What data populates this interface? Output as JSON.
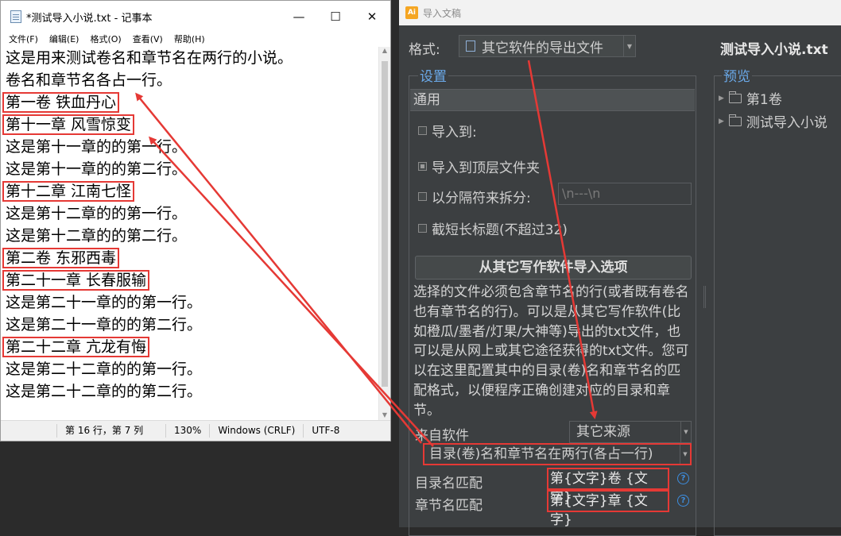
{
  "notepad": {
    "title": "*测试导入小说.txt - 记事本",
    "window_buttons": {
      "minimize": "—",
      "maximize": "☐",
      "close": "✕"
    },
    "menu": [
      "文件(F)",
      "编辑(E)",
      "格式(O)",
      "查看(V)",
      "帮助(H)"
    ],
    "lines": [
      {
        "text": "这是用来测试卷名和章节名在两行的小说。",
        "highlight": false
      },
      {
        "text": "卷名和章节名各占一行。",
        "highlight": false
      },
      {
        "text": "第一卷 铁血丹心",
        "highlight": true
      },
      {
        "text": "第十一章 风雪惊变",
        "highlight": true
      },
      {
        "text": "这是第十一章的的第一行。",
        "highlight": false
      },
      {
        "text": "这是第十一章的的第二行。",
        "highlight": false
      },
      {
        "text": "第十二章 江南七怪",
        "highlight": true
      },
      {
        "text": "这是第十二章的的第一行。",
        "highlight": false
      },
      {
        "text": "这是第十二章的的第二行。",
        "highlight": false
      },
      {
        "text": "第二卷 东邪西毒",
        "highlight": true
      },
      {
        "text": "第二十一章 长春服输",
        "highlight": true
      },
      {
        "text": "这是第二十一章的的第一行。",
        "highlight": false
      },
      {
        "text": "这是第二十一章的的第二行。",
        "highlight": false
      },
      {
        "text": "第二十二章 亢龙有悔",
        "highlight": true
      },
      {
        "text": "这是第二十二章的的第一行。",
        "highlight": false
      },
      {
        "text": "这是第二十二章的的第二行。",
        "highlight": false
      },
      {
        "text": "",
        "highlight": false
      },
      {
        "text": ".......",
        "highlight": false
      }
    ],
    "status": {
      "position": "第 16 行，第 7 列",
      "zoom": "130%",
      "line_ending": "Windows (CRLF)",
      "encoding": "UTF-8"
    }
  },
  "import_dialog": {
    "app_icon": "Ai",
    "title": "导入文稿",
    "format_label": "格式:",
    "format_value": "其它软件的导出文件",
    "settings_label": "设置",
    "general_label": "通用",
    "options": [
      {
        "label": "导入到:",
        "checked": false
      },
      {
        "label": "导入到顶层文件夹",
        "checked": true
      },
      {
        "label": "以分隔符来拆分:",
        "checked": false
      },
      {
        "label": "截短长标题(不超过32)",
        "checked": false
      }
    ],
    "separator_value": "\\n---\\n",
    "section_title": "从其它写作软件导入选项",
    "description": "选择的文件必须包含章节名的行(或者既有卷名也有章节名的行)。可以是从其它写作软件(比如橙瓜/墨者/灯果/大神等)导出的txt文件，也可以是从网上或其它途径获得的txt文件。您可以在这里配置其中的目录(卷)名和章节名的匹配格式，以便程序正确创建对应的目录和章节。",
    "source_label": "来自软件",
    "source_value": "其它来源",
    "mode_value": "目录(卷)名和章节名在两行(各占一行)",
    "catalog_label": "目录名匹配",
    "catalog_pattern": "第{文字}卷 {文字}",
    "chapter_label": "章节名匹配",
    "chapter_pattern": "第{文字}章 {文字}",
    "help_glyph": "?",
    "preview_file": "测试导入小说.txt",
    "preview_label": "预览",
    "tree": [
      "第1卷",
      "测试导入小说"
    ]
  },
  "colors": {
    "annotation": "#e53935",
    "dialog_bg": "#3c3f41",
    "link_blue": "#6aa9e9"
  }
}
